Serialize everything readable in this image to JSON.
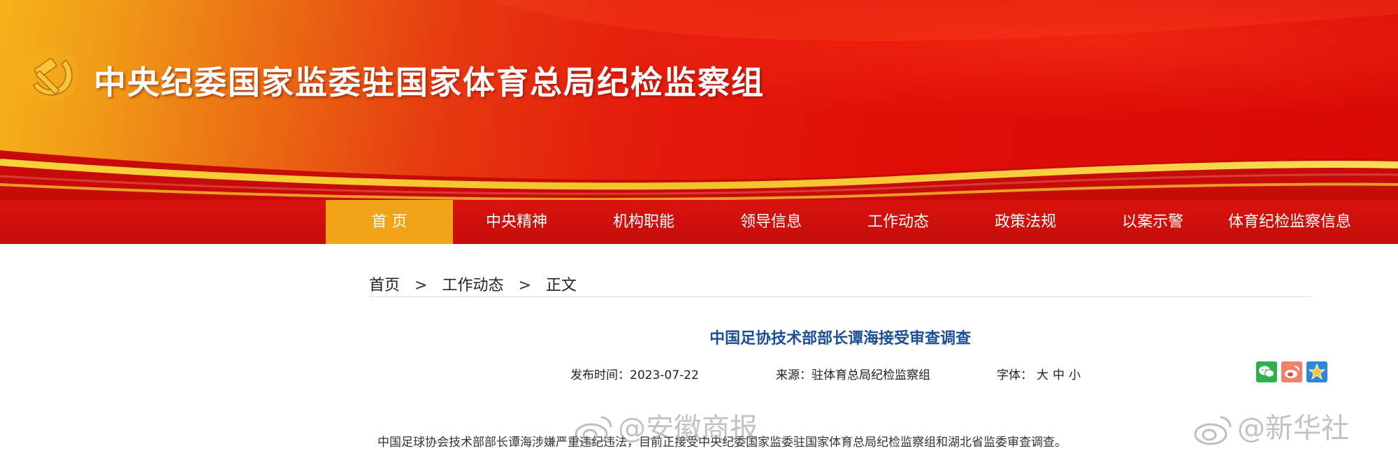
{
  "header": {
    "site_title": "中央纪委国家监委驻国家体育总局纪检监察组",
    "emblem_icon": "party-emblem-icon"
  },
  "nav": {
    "items": [
      {
        "label": "首 页",
        "active": true
      },
      {
        "label": "中央精神"
      },
      {
        "label": "机构职能"
      },
      {
        "label": "领导信息"
      },
      {
        "label": "工作动态"
      },
      {
        "label": "政策法规"
      },
      {
        "label": "以案示警"
      },
      {
        "label": "体育纪检监察信息"
      }
    ]
  },
  "breadcrumb": {
    "home": "首页",
    "section": "工作动态",
    "current": "正文",
    "separator": ">"
  },
  "article": {
    "title": "中国足协技术部部长谭海接受审查调查",
    "date_label": "发布时间：",
    "date": "2023-07-22",
    "source_label": "来源：",
    "source": "驻体育总局纪检监察组",
    "font_label": "字体：",
    "font_sizes": [
      "大",
      "中",
      "小"
    ],
    "share_icons": [
      "wechat-icon",
      "weibo-icon",
      "qzone-icon"
    ],
    "body_text": "中国足球协会技术部部长谭海涉嫌严重违纪违法，目前正接受中央纪委国家监委驻国家体育总局纪检监察组和湖北省监委审查调查。"
  },
  "watermarks": {
    "left": "@安徽商报",
    "right": "@新华社"
  },
  "colors": {
    "banner_red": "#d80a06",
    "banner_orange": "#f09a17",
    "nav_red": "#c50d0a",
    "nav_active": "#f2a419",
    "title_blue": "#1d4f96"
  }
}
